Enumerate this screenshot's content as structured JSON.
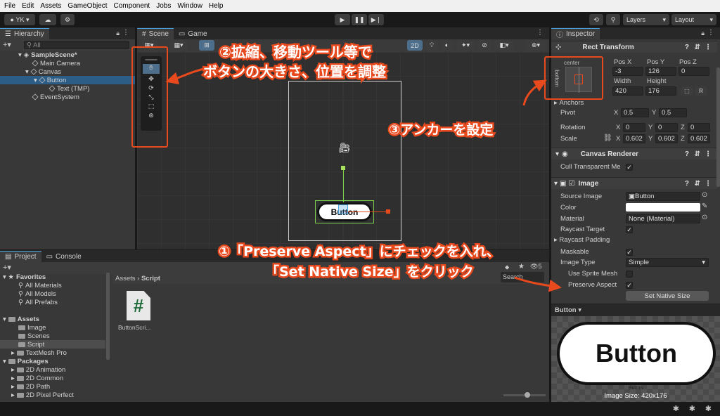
{
  "menubar": [
    "File",
    "Edit",
    "Assets",
    "GameObject",
    "Component",
    "Jobs",
    "Window",
    "Help"
  ],
  "toolbar": {
    "account": "YK",
    "layers": "Layers",
    "layout": "Layout"
  },
  "hierarchy": {
    "tab": "Hierarchy",
    "search_placeholder": "All",
    "items": [
      "SampleScene*",
      "Main Camera",
      "Canvas",
      "Button",
      "Text (TMP)",
      "EventSystem"
    ]
  },
  "scene": {
    "tabs": [
      "Scene",
      "Game"
    ],
    "mode_2d": "2D",
    "button_text": "Button"
  },
  "project": {
    "tabs": [
      "Project",
      "Console"
    ],
    "favorites_label": "Favorites",
    "favorites": [
      "All Materials",
      "All Models",
      "All Prefabs"
    ],
    "assets_label": "Assets",
    "assets": [
      "Image",
      "Scenes",
      "Script",
      "TextMesh Pro"
    ],
    "packages_label": "Packages",
    "packages": [
      "2D Animation",
      "2D Common",
      "2D Path",
      "2D Pixel Perfect"
    ],
    "breadcrumb_root": "Assets",
    "breadcrumb_leaf": "Script",
    "file_name": "ButtonScri...",
    "file_icon": "#",
    "search_label": "Search",
    "count": "5"
  },
  "inspector": {
    "tab": "Inspector",
    "rect_transform": {
      "title": "Rect Transform",
      "anchor_top": "center",
      "anchor_side": "bottom",
      "labels": [
        "Pos X",
        "Pos Y",
        "Pos Z",
        "Width",
        "Height"
      ],
      "pos_x": "-3",
      "pos_y": "126",
      "pos_z": "0",
      "width": "420",
      "height": "176",
      "r_button": "R",
      "anchors": "Anchors",
      "pivot": "Pivot",
      "pivot_x": "0.5",
      "pivot_y": "0.5",
      "rotation": "Rotation",
      "rot_x": "0",
      "rot_y": "0",
      "rot_z": "0",
      "scale": "Scale",
      "scale_x": "0.602",
      "scale_y": "0.602",
      "scale_z": "0.602"
    },
    "canvas_renderer": {
      "title": "Canvas Renderer",
      "cull_label": "Cull Transparent Me"
    },
    "image": {
      "title": "Image",
      "source_image_label": "Source Image",
      "source_image": "Button",
      "color_label": "Color",
      "material_label": "Material",
      "material": "None (Material)",
      "raycast_target": "Raycast Target",
      "raycast_padding": "Raycast Padding",
      "maskable": "Maskable",
      "image_type_label": "Image Type",
      "image_type": "Simple",
      "use_sprite_mesh": "Use Sprite Mesh",
      "preserve_aspect": "Preserve Aspect",
      "set_native_size": "Set Native Size"
    },
    "preview": {
      "title": "Button",
      "button_text": "Button",
      "caption": "Button",
      "size": "Image Size: 420x176"
    }
  },
  "annotations": {
    "a2_line1": "②拡縮、移動ツール等で",
    "a2_line2": "ボタンの大きさ、位置を調整",
    "a3": "③アンカーを設定",
    "a1_line1": "①「Preserve Aspect」にチェックを入れ、",
    "a1_line2": "「Set Native Size」をクリック"
  },
  "colors": {
    "accent": "#4aa3df",
    "annotation": "#e8491d"
  }
}
